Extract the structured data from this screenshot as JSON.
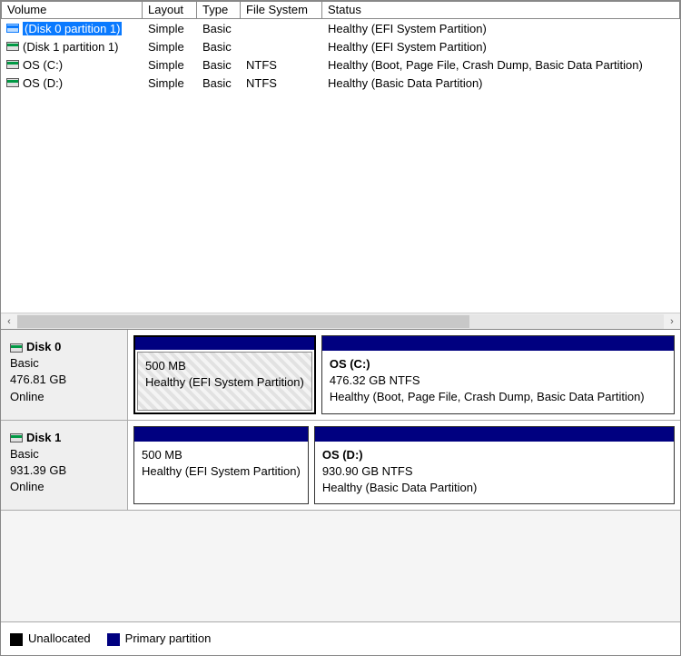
{
  "columns": {
    "volume": "Volume",
    "layout": "Layout",
    "type": "Type",
    "fs": "File System",
    "status": "Status"
  },
  "volumes": [
    {
      "name": "(Disk 0 partition 1)",
      "layout": "Simple",
      "type": "Basic",
      "fs": "",
      "status": "Healthy (EFI System Partition)",
      "selected": true
    },
    {
      "name": "(Disk 1 partition 1)",
      "layout": "Simple",
      "type": "Basic",
      "fs": "",
      "status": "Healthy (EFI System Partition)",
      "selected": false
    },
    {
      "name": "OS (C:)",
      "layout": "Simple",
      "type": "Basic",
      "fs": "NTFS",
      "status": "Healthy (Boot, Page File, Crash Dump, Basic Data Partition)",
      "selected": false
    },
    {
      "name": "OS (D:)",
      "layout": "Simple",
      "type": "Basic",
      "fs": "NTFS",
      "status": "Healthy (Basic Data Partition)",
      "selected": false
    }
  ],
  "disks": [
    {
      "name": "Disk 0",
      "type": "Basic",
      "size": "476.81 GB",
      "state": "Online",
      "parts": [
        {
          "title": "",
          "size_line": "500 MB",
          "status_line": "Healthy (EFI System Partition)",
          "flex": 30,
          "selected": true
        },
        {
          "title": "OS  (C:)",
          "size_line": "476.32 GB NTFS",
          "status_line": "Healthy (Boot, Page File, Crash Dump, Basic Data Partition)",
          "flex": 70,
          "selected": false
        }
      ]
    },
    {
      "name": "Disk 1",
      "type": "Basic",
      "size": "931.39 GB",
      "state": "Online",
      "parts": [
        {
          "title": "",
          "size_line": "500 MB",
          "status_line": "Healthy (EFI System Partition)",
          "flex": 30,
          "selected": false
        },
        {
          "title": "OS  (D:)",
          "size_line": "930.90 GB NTFS",
          "status_line": "Healthy (Basic Data Partition)",
          "flex": 70,
          "selected": false
        }
      ]
    }
  ],
  "legend": {
    "unallocated": "Unallocated",
    "primary": "Primary partition"
  }
}
